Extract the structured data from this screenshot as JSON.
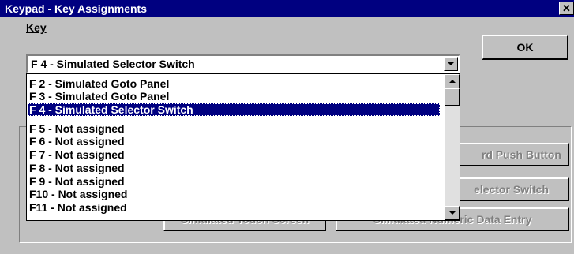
{
  "window": {
    "title": "Keypad - Key Assignments",
    "close_glyph": "✕"
  },
  "key": {
    "label": "Key",
    "mnemonic": "K",
    "selected_value": "F 4 - Simulated Selector Switch"
  },
  "ok_button": {
    "label": "OK"
  },
  "dropdown": {
    "items": [
      "F 2 - Simulated Goto Panel",
      "F 3 - Simulated Goto Panel",
      "F 4 - Simulated Selector Switch",
      "F 5 - Not assigned",
      "F 6 - Not assigned",
      "F 7 - Not assigned",
      "F 8 - Not assigned",
      "F 9 - Not assigned",
      "F10 - Not assigned",
      "F11 - Not assigned"
    ],
    "selected_index": 2
  },
  "group_buttons": {
    "push_button": "rd Push Button",
    "selector_switch": "elector Switch",
    "touch_screen": "Simulated Touch Screen",
    "numeric_entry": "Simulated Numeric Data Entry"
  },
  "colors": {
    "titlebar": "#000080",
    "selection": "#000080",
    "face": "#c0c0c0"
  }
}
